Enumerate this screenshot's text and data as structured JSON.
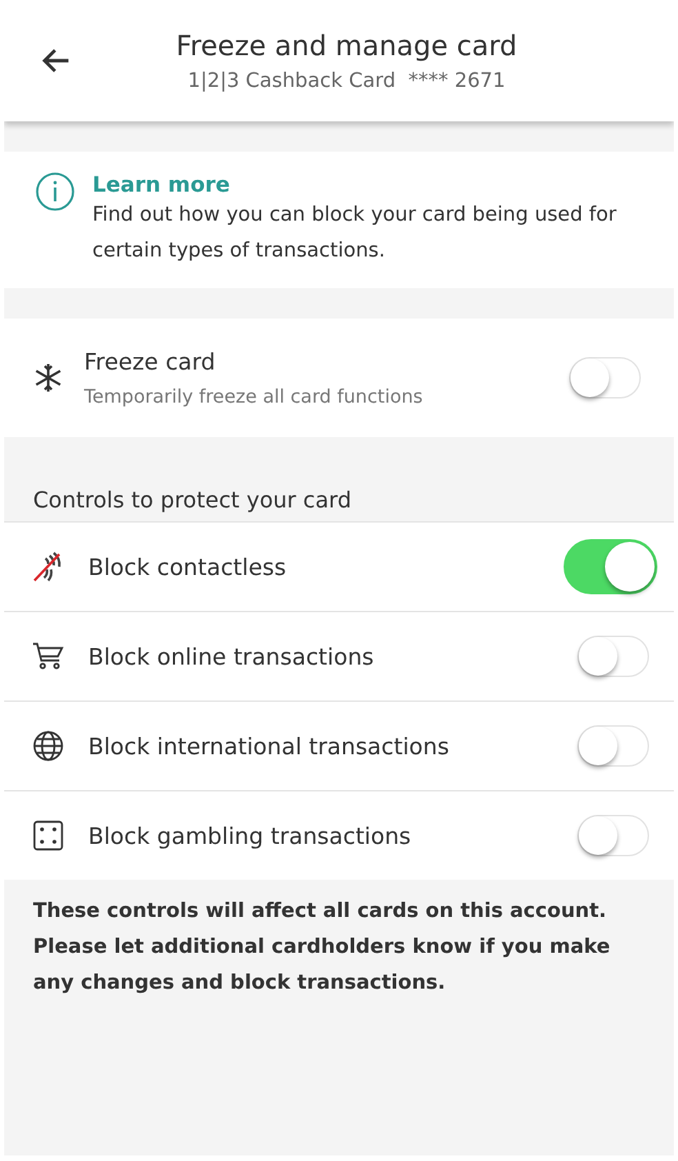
{
  "header": {
    "title": "Freeze and manage card",
    "subtitle": "1|2|3 Cashback Card  **** 2671"
  },
  "info": {
    "link": "Learn more",
    "text": "Find out how you can block your card being used for certain types of transactions."
  },
  "freeze": {
    "label": "Freeze card",
    "description": "Temporarily freeze all card functions",
    "on": false
  },
  "controls": {
    "heading": "Controls to protect your card",
    "items": [
      {
        "label": "Block contactless",
        "on": true
      },
      {
        "label": "Block online transactions",
        "on": false
      },
      {
        "label": "Block international transactions",
        "on": false
      },
      {
        "label": "Block gambling transactions",
        "on": false
      }
    ]
  },
  "note": "These controls will affect all cards on this account. Please let additional cardholders know if you make any changes and block transactions."
}
